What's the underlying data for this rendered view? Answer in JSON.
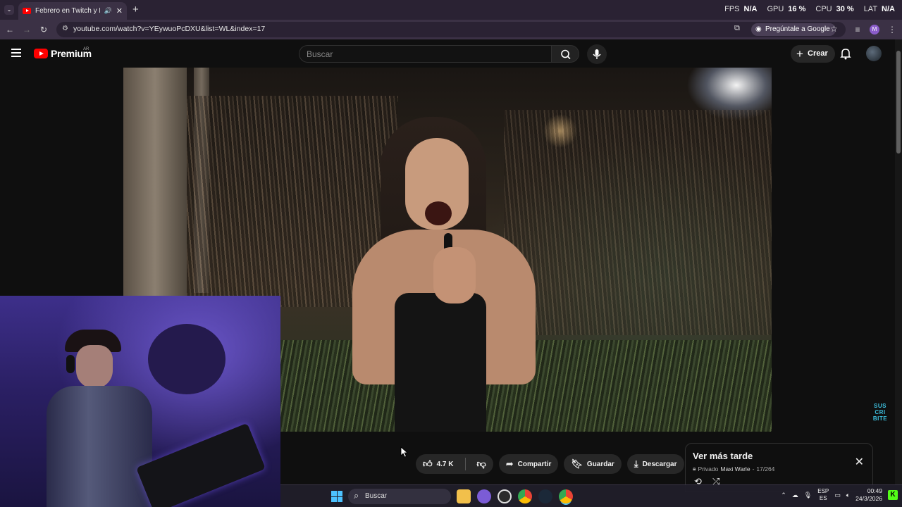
{
  "browser": {
    "tab_title": "Febrero en Twitch y Kick Ar",
    "url": "youtube.com/watch?v=YEywuoPcDXU&list=WL&index=17",
    "ask_google": "Pregúntale a Google",
    "profile_initial": "M"
  },
  "overlay_stats": {
    "fps_label": "FPS",
    "fps_value": "N/A",
    "gpu_label": "GPU",
    "gpu_value": "16 %",
    "cpu_label": "CPU",
    "cpu_value": "30 %",
    "lat_label": "LAT",
    "lat_value": "N/A"
  },
  "youtube": {
    "logo_text": "Premium",
    "region": "AR",
    "search_placeholder": "Buscar",
    "create_label": "Crear"
  },
  "video": {
    "corner_badge_lines": [
      "SUS",
      "CRI",
      "BITE"
    ]
  },
  "actions": {
    "likes": "4.7 K",
    "share": "Compartir",
    "save": "Guardar",
    "download": "Descargar"
  },
  "playlist_panel": {
    "title": "Ver más tarde",
    "privacy": "Privado",
    "owner": "Maxi Warle",
    "position": "17/264"
  },
  "taskbar": {
    "search": "Buscar",
    "lang_top": "ESP",
    "lang_bottom": "ES",
    "time": "00:49",
    "date": "24/3/2026",
    "notification_badge": "K"
  },
  "colors": {
    "youtube_red": "#ff0000",
    "browser_frame": "#2a2233",
    "windows_accent": "#4cc2ff",
    "kick_green": "#53fc18"
  }
}
